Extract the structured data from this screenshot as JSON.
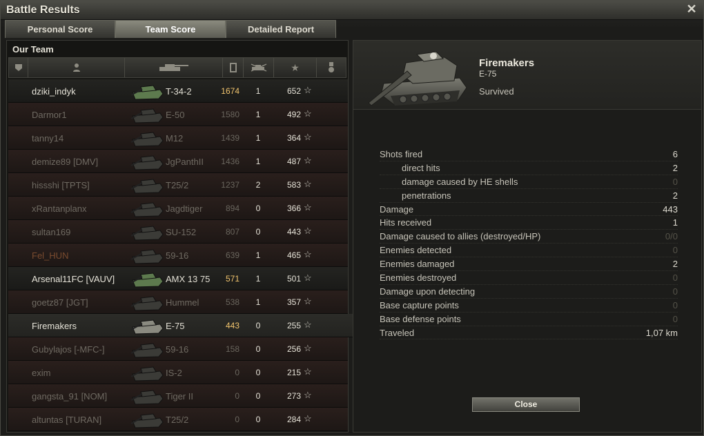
{
  "window": {
    "title": "Battle Results"
  },
  "tabs": [
    {
      "label": "Personal Score",
      "active": false
    },
    {
      "label": "Team Score",
      "active": true
    },
    {
      "label": "Detailed Report",
      "active": false
    }
  ],
  "team": {
    "title": "Our Team",
    "columns": [
      "platoon-icon",
      "player-icon",
      "tank-icon",
      "damage-icon",
      "kills-icon",
      "xp-star-icon",
      "medal-icon"
    ],
    "rows": [
      {
        "name": "dziki_indyk",
        "vehicle": "T-34-2",
        "damage": "1674",
        "kills": "1",
        "xp": "652",
        "state": "alive"
      },
      {
        "name": "Darmor1",
        "vehicle": "E-50",
        "damage": "1580",
        "kills": "1",
        "xp": "492",
        "state": "dead"
      },
      {
        "name": "tanny14",
        "vehicle": "M12",
        "damage": "1439",
        "kills": "1",
        "xp": "364",
        "state": "dead"
      },
      {
        "name": "demize89 [DMV]",
        "vehicle": "JgPanthII",
        "damage": "1436",
        "kills": "1",
        "xp": "487",
        "state": "dead"
      },
      {
        "name": "hissshi [TPTS]",
        "vehicle": "T25/2",
        "damage": "1237",
        "kills": "2",
        "xp": "583",
        "state": "dead"
      },
      {
        "name": "xRantanplanx",
        "vehicle": "Jagdtiger",
        "damage": "894",
        "kills": "0",
        "xp": "366",
        "state": "dead"
      },
      {
        "name": "sultan169",
        "vehicle": "SU-152",
        "damage": "807",
        "kills": "0",
        "xp": "443",
        "state": "dead"
      },
      {
        "name": "Fel_HUN",
        "vehicle": "59-16",
        "damage": "639",
        "kills": "1",
        "xp": "465",
        "state": "teamkiller"
      },
      {
        "name": "Arsenal11FC [VAUV]",
        "vehicle": "AMX 13 75",
        "damage": "571",
        "kills": "1",
        "xp": "501",
        "state": "alive"
      },
      {
        "name": "goetz87 [JGT]",
        "vehicle": "Hummel",
        "damage": "538",
        "kills": "1",
        "xp": "357",
        "state": "dead"
      },
      {
        "name": "Firemakers",
        "vehicle": "E-75",
        "damage": "443",
        "kills": "0",
        "xp": "255",
        "state": "player"
      },
      {
        "name": "Gubylajos [-MFC-]",
        "vehicle": "59-16",
        "damage": "158",
        "kills": "0",
        "xp": "256",
        "state": "dead"
      },
      {
        "name": "exim",
        "vehicle": "IS-2",
        "damage": "0",
        "kills": "0",
        "xp": "215",
        "state": "dead"
      },
      {
        "name": "gangsta_91 [NOM]",
        "vehicle": "Tiger II",
        "damage": "0",
        "kills": "0",
        "xp": "273",
        "state": "dead"
      },
      {
        "name": "altuntas [TURAN]",
        "vehicle": "T25/2",
        "damage": "0",
        "kills": "0",
        "xp": "284",
        "state": "dead"
      }
    ]
  },
  "detail": {
    "player_name": "Firemakers",
    "vehicle": "E-75",
    "status": "Survived",
    "stats": [
      {
        "label": "Shots fired",
        "value": "6",
        "sub": false
      },
      {
        "label": "direct hits",
        "value": "2",
        "sub": true
      },
      {
        "label": "damage caused by HE shells",
        "value": "0",
        "sub": true
      },
      {
        "label": "penetrations",
        "value": "2",
        "sub": true
      },
      {
        "label": "Damage",
        "value": "443",
        "sub": false
      },
      {
        "label": "Hits received",
        "value": "1",
        "sub": false
      },
      {
        "label": "Damage caused to allies (destroyed/HP)",
        "value": "0/0",
        "sub": false
      },
      {
        "label": "Enemies detected",
        "value": "0",
        "sub": false
      },
      {
        "label": "Enemies damaged",
        "value": "2",
        "sub": false
      },
      {
        "label": "Enemies destroyed",
        "value": "0",
        "sub": false
      },
      {
        "label": "Damage upon detecting",
        "value": "0",
        "sub": false
      },
      {
        "label": "Base capture points",
        "value": "0",
        "sub": false
      },
      {
        "label": "Base defense points",
        "value": "0",
        "sub": false
      },
      {
        "label": "Traveled",
        "value": "1,07 km",
        "sub": false
      }
    ],
    "close_label": "Close"
  },
  "colors": {
    "damage": "#f2c56e",
    "dead_row": "#2a1f1c",
    "teamkiller_name": "#7a4b2f"
  }
}
